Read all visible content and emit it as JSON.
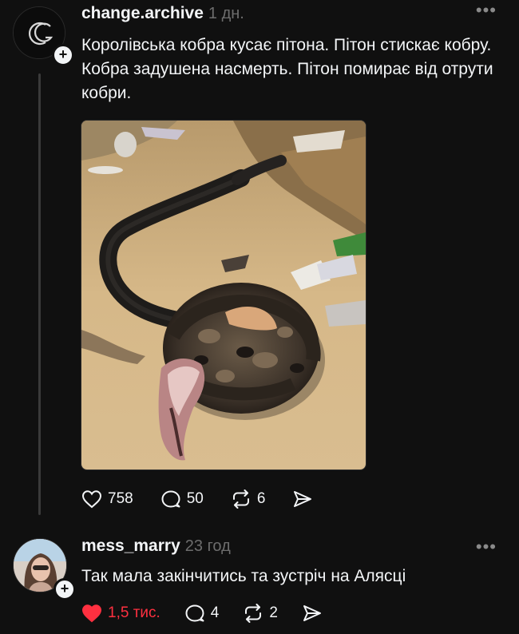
{
  "post": {
    "username": "change.archive",
    "time": "1 дн.",
    "avatar_logo": "CG",
    "text": "Королівська кобра кусає пітона. Пітон стискає кобру. Кобра задушена насмерть. Пітон помирає від отрути кобри.",
    "actions": {
      "likes": "758",
      "comments": "50",
      "reposts": "6"
    }
  },
  "reply": {
    "username": "mess_marry",
    "time": "23 год",
    "text": "Так мала закінчитись та зустріч на Алясці",
    "actions": {
      "likes": "1,5 тис.",
      "comments": "4",
      "reposts": "2"
    },
    "liked": true
  },
  "colors": {
    "background": "#101010",
    "text": "#f3f5f7",
    "muted": "#6d6d6d",
    "like_active": "#ff3040"
  },
  "icons": [
    "heart-icon",
    "comment-icon",
    "repost-icon",
    "share-icon",
    "more-icon",
    "plus-icon"
  ]
}
